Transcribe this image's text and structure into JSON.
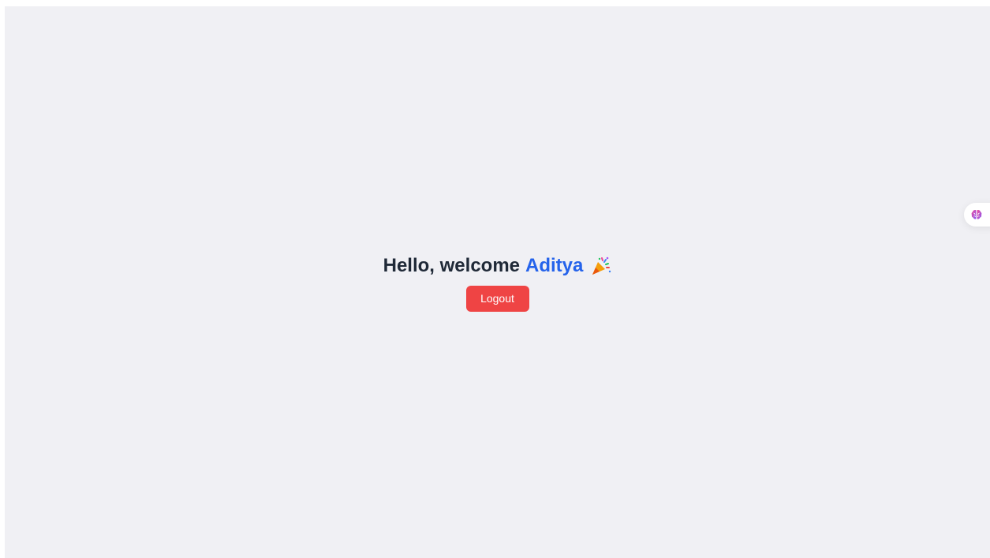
{
  "greeting": {
    "prefix": "Hello, welcome",
    "name": "Aditya",
    "emoji_icon": "party-popper-icon"
  },
  "actions": {
    "logout_label": "Logout"
  },
  "side_widget": {
    "icon": "brain-icon"
  },
  "colors": {
    "background": "#f0f0f4",
    "heading": "#1f2937",
    "accent": "#2563eb",
    "danger": "#ef4444"
  }
}
